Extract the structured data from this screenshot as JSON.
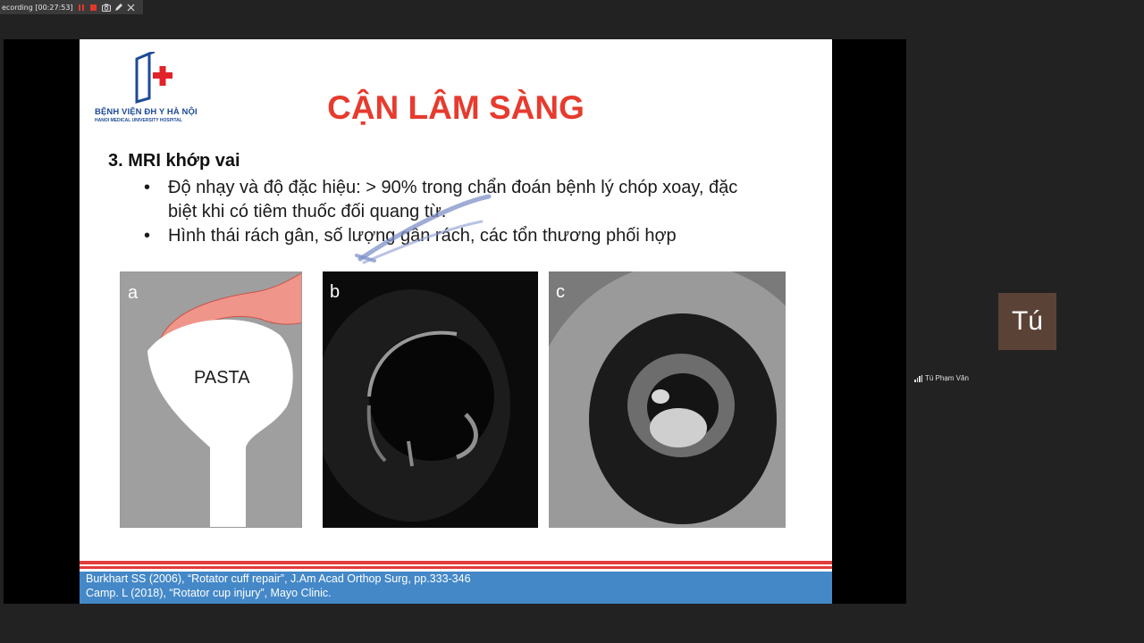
{
  "recording": {
    "label": "ecording [00:27:53]",
    "controls": [
      "pause-icon",
      "stop-icon",
      "camera-icon",
      "pen-icon",
      "close-icon"
    ],
    "accent_color": "#e2382c"
  },
  "slide": {
    "logo": {
      "line1": "BỆNH VIỆN ĐH Y HÀ NỘI",
      "line2": "HANOI MEDICAL UNIVERSITY HOSPITAL"
    },
    "title": "CẬN LÂM SÀNG",
    "section_heading": "3. MRI khớp vai",
    "bullets": [
      {
        "marker": "•",
        "text": "Độ nhạy và độ đặc hiệu: > 90% trong chẩn đoán bệnh lý chóp xoay, đặc biệt khi có tiêm thuốc đối quang từ."
      },
      {
        "marker": "•",
        "text": "Hình thái rách gân, số lượng gân rách, các tổn thương phối hợp"
      }
    ],
    "figures": [
      {
        "label": "a",
        "text": "PASTA"
      },
      {
        "label": "b"
      },
      {
        "label": "c"
      }
    ],
    "references": [
      "Burkhart SS (2006), “Rotator cuff repair”, J.Am Acad Orthop Surg, pp.333-346",
      "Camp. L (2018), “Rotator cup injury”, Mayo Clinic."
    ],
    "colors": {
      "title": "#e63b2e",
      "footer": "#4488c8",
      "footer_stripe": "#e23b3b"
    }
  },
  "participant": {
    "initials": "Tú",
    "name": "Tú Phạm Văn",
    "tile_color": "#5b4236"
  }
}
